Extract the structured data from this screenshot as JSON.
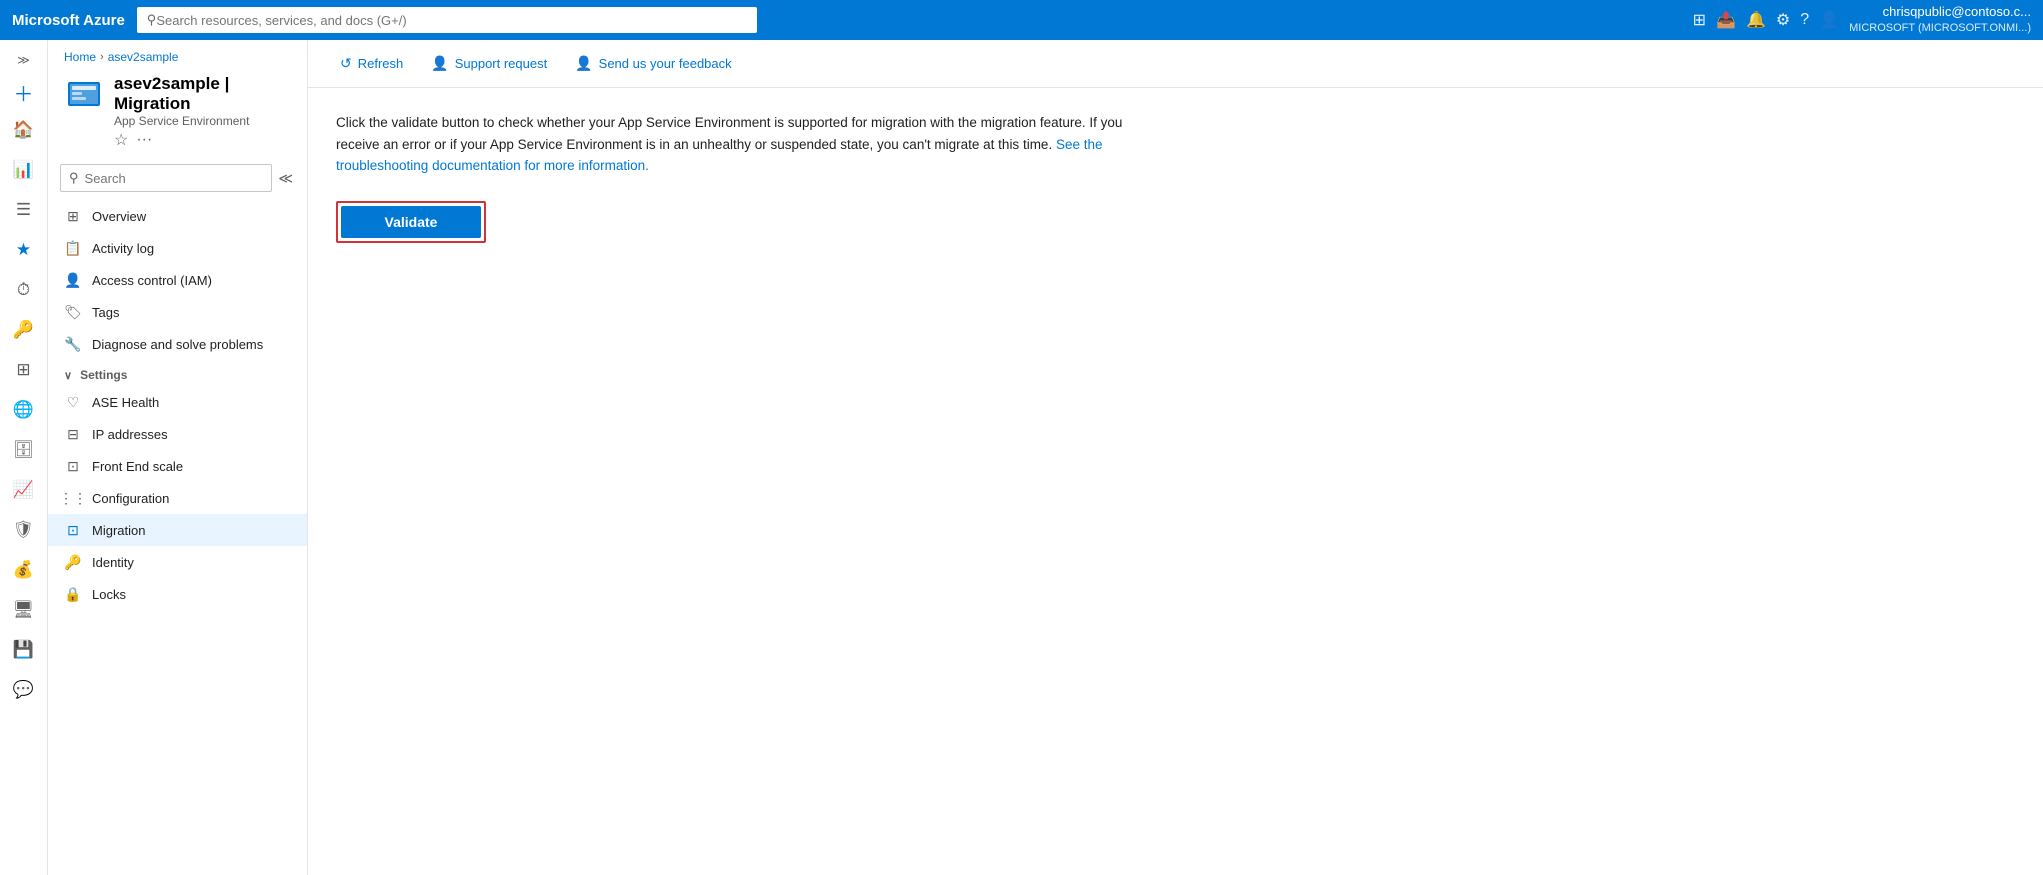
{
  "topnav": {
    "logo": "Microsoft Azure",
    "search_placeholder": "Search resources, services, and docs (G+/)",
    "user": {
      "name": "chrisqpublic@contoso.c...",
      "tenant": "MICROSOFT (MICROSOFT.ONMI...)"
    }
  },
  "breadcrumb": {
    "home": "Home",
    "resource": "asev2sample"
  },
  "resource": {
    "name": "asev2sample | Migration",
    "type": "App Service Environment",
    "favorite_label": "★",
    "more_label": "···"
  },
  "sidebar": {
    "search_placeholder": "Search",
    "nav_items": [
      {
        "id": "overview",
        "label": "Overview",
        "icon": "⊞"
      },
      {
        "id": "activity-log",
        "label": "Activity log",
        "icon": "📋"
      },
      {
        "id": "access-control",
        "label": "Access control (IAM)",
        "icon": "👤"
      },
      {
        "id": "tags",
        "label": "Tags",
        "icon": "🏷"
      },
      {
        "id": "diagnose",
        "label": "Diagnose and solve problems",
        "icon": "🔧"
      }
    ],
    "settings_section": "Settings",
    "settings_items": [
      {
        "id": "ase-health",
        "label": "ASE Health",
        "icon": "♡"
      },
      {
        "id": "ip-addresses",
        "label": "IP addresses",
        "icon": "⊟"
      },
      {
        "id": "front-end-scale",
        "label": "Front End scale",
        "icon": "⊡"
      },
      {
        "id": "configuration",
        "label": "Configuration",
        "icon": "⋮⋮⋮"
      },
      {
        "id": "migration",
        "label": "Migration",
        "icon": "⊡",
        "active": true
      },
      {
        "id": "identity",
        "label": "Identity",
        "icon": "🔑"
      },
      {
        "id": "locks",
        "label": "Locks",
        "icon": "🔒"
      }
    ]
  },
  "toolbar": {
    "refresh_label": "Refresh",
    "support_label": "Support request",
    "feedback_label": "Send us your feedback"
  },
  "content": {
    "description": "Click the validate button to check whether your App Service Environment is supported for migration with the migration feature. If you receive an error or if your App Service Environment is in an unhealthy or suspended state, you can't migrate at this time.",
    "link_text": "See the troubleshooting documentation for more information.",
    "link_href": "#",
    "validate_label": "Validate"
  },
  "icons": {
    "portal": "⊞",
    "home": "🏠",
    "dashboard": "📊",
    "menu": "☰",
    "favorites": "★",
    "globe": "🌐",
    "notification": "🔔",
    "settings": "⚙",
    "help": "?",
    "feedback": "👤",
    "expand": "≫",
    "collapse": "≪",
    "search": "🔍",
    "refresh_icon": "↺",
    "support_icon": "👤",
    "feedback_icon": "👤",
    "chevron_down": "∨"
  }
}
